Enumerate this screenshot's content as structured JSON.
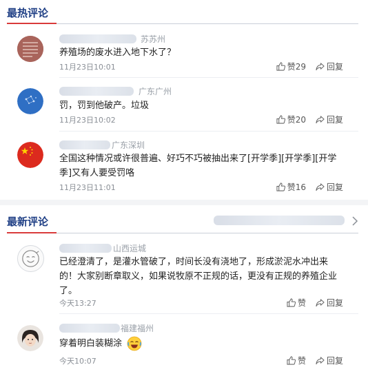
{
  "hot_section": {
    "title": "最热评论"
  },
  "new_section": {
    "title": "最新评论"
  },
  "hot_comments": [
    {
      "location": "苏苏州",
      "content": "养殖场的废水进入地下水了？",
      "time": "11月23日10:01",
      "like_label": "赞29",
      "reply_label": "回复"
    },
    {
      "location": "广东广州",
      "content": "罚，罚到他破产。垃圾",
      "time": "11月23日10:02",
      "like_label": "赞20",
      "reply_label": "回复"
    },
    {
      "location": "广东深圳",
      "content_lines": [
        "全国这种情况或许很普遍、好巧不巧被抽出来了[开学季][开学季][开学",
        "季]又有人要受罚咯"
      ],
      "time": "11月23日11:01",
      "like_label": "赞16",
      "reply_label": "回复"
    }
  ],
  "new_comments": [
    {
      "location": "山西运城",
      "content_lines": [
        "已经澄清了，是灌水管破了，时间长没有浇地了，形成淤泥水冲出来",
        "的！大家别断章取义，如果说牧原不正规的话，更没有正规的养殖企业",
        "了。"
      ],
      "time": "今天13:27",
      "like_label": "赞",
      "reply_label": "回复"
    },
    {
      "location": "福建福州",
      "content": "穿着明白装糊涂",
      "time": "今天10:07",
      "like_label": "赞",
      "reply_label": "回复"
    }
  ],
  "icons": {
    "like": "thumbs-up-icon",
    "reply": "share-arrow-icon",
    "more": "chevron-right-icon",
    "emoji": "laughing-tears-emoji"
  },
  "colors": {
    "section_title": "#1f3f85",
    "accent": "#d93a3a"
  }
}
